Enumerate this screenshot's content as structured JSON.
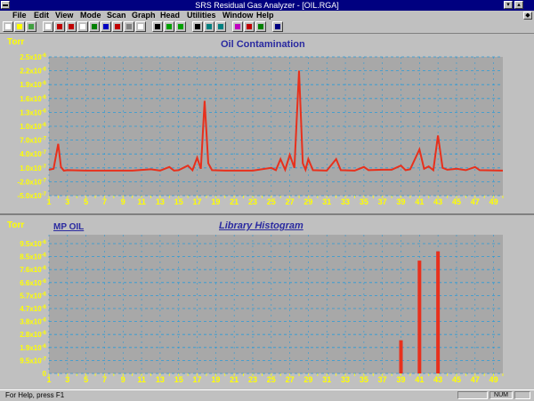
{
  "window": {
    "title": "SRS Residual Gas Analyzer - [OIL.RGA]"
  },
  "menu": [
    "File",
    "Edit",
    "View",
    "Mode",
    "Scan",
    "Graph",
    "Head",
    "Utilities",
    "Window",
    "Help"
  ],
  "toolbar": {
    "buttons": [
      "new-file-icon",
      "open-file-icon",
      "save-icon",
      "print-icon",
      "analog-scan-icon",
      "histogram-icon",
      "table-icon",
      "leak-test-icon",
      "pressure-icon",
      "trend-icon",
      "grid-icon",
      "zoom-icon",
      "autoscale-icon",
      "filament-icon",
      "emission-icon",
      "move-icon",
      "left-arrow-icon",
      "right-arrow-icon",
      "library-icon",
      "compare-icon",
      "record-icon",
      "help-icon"
    ]
  },
  "top_panel": {
    "title": "Oil Contamination",
    "unit": "Torr",
    "y_ticks": [
      "2.5x10-6",
      "2.2x10-6",
      "1.9x10-6",
      "1.6x10-6",
      "1.3x10-6",
      "1.0x10-6",
      "7.0x10-7",
      "4.0x10-7",
      "1.0x10-7",
      "-2.0x10-7",
      "-5.0x10-7"
    ],
    "x_ticks": [
      "1",
      "3",
      "5",
      "7",
      "9",
      "11",
      "13",
      "15",
      "17",
      "19",
      "21",
      "23",
      "25",
      "27",
      "29",
      "31",
      "33",
      "35",
      "37",
      "39",
      "41",
      "43",
      "45",
      "47",
      "49"
    ]
  },
  "bottom_panel": {
    "title": "Library Histogram",
    "library_label": "MP OIL",
    "unit": "Torr",
    "y_ticks": [
      "9.5x10-6",
      "8.5x10-6",
      "7.6x10-6",
      "6.6x10-6",
      "5.7x10-6",
      "4.7x10-6",
      "3.8x10-6",
      "2.8x10-6",
      "1.9x10-6",
      "9.5x10-7",
      "0"
    ],
    "x_ticks": [
      "1",
      "3",
      "5",
      "7",
      "9",
      "11",
      "13",
      "15",
      "17",
      "19",
      "21",
      "23",
      "25",
      "27",
      "29",
      "31",
      "33",
      "35",
      "37",
      "39",
      "41",
      "43",
      "45",
      "47",
      "49"
    ]
  },
  "status": {
    "help_text": "For Help, press F1",
    "num": "NUM"
  },
  "colors": {
    "trace": "#e8301c",
    "plot_bg": "#a8a8a8",
    "grid": "#2a9ad8",
    "axis_text": "#ffff00",
    "title_text": "#2a2aa0"
  },
  "chart_data": [
    {
      "type": "line",
      "title": "Oil Contamination",
      "ylabel": "Torr",
      "xlabel": "",
      "xlim": [
        1,
        50
      ],
      "ylim": [
        -5e-07,
        2.5e-06
      ],
      "grid": true,
      "series": [
        {
          "values": [
            [
              1,
              6e-08
            ],
            [
              1.5,
              8e-08
            ],
            [
              2,
              6.2e-07
            ],
            [
              2.3,
              1.2e-07
            ],
            [
              2.6,
              4e-08
            ],
            [
              3,
              5e-08
            ],
            [
              5,
              4e-08
            ],
            [
              10,
              4e-08
            ],
            [
              12,
              7e-08
            ],
            [
              13,
              4e-08
            ],
            [
              14,
              1.2e-07
            ],
            [
              14.5,
              4e-08
            ],
            [
              15,
              5e-08
            ],
            [
              16,
              1.5e-07
            ],
            [
              16.5,
              5e-08
            ],
            [
              17,
              3.2e-07
            ],
            [
              17.4,
              8e-08
            ],
            [
              17.8,
              1.55e-06
            ],
            [
              18.2,
              2e-07
            ],
            [
              18.6,
              5e-08
            ],
            [
              20,
              4e-08
            ],
            [
              23,
              4e-08
            ],
            [
              25,
              1e-07
            ],
            [
              25.5,
              5e-08
            ],
            [
              26,
              2.9e-07
            ],
            [
              26.5,
              6e-08
            ],
            [
              27,
              3.8e-07
            ],
            [
              27.5,
              1e-07
            ],
            [
              28,
              2.2e-06
            ],
            [
              28.4,
              2e-07
            ],
            [
              28.7,
              6e-08
            ],
            [
              29,
              2.9e-07
            ],
            [
              29.5,
              5e-08
            ],
            [
              31,
              4e-08
            ],
            [
              32,
              2.9e-07
            ],
            [
              32.5,
              5e-08
            ],
            [
              34,
              4e-08
            ],
            [
              35,
              1.2e-07
            ],
            [
              35.5,
              5e-08
            ],
            [
              37,
              6e-08
            ],
            [
              38,
              6e-08
            ],
            [
              39,
              1.5e-07
            ],
            [
              39.5,
              5e-08
            ],
            [
              40,
              7e-08
            ],
            [
              41,
              5e-07
            ],
            [
              41.5,
              8e-08
            ],
            [
              42,
              1.3e-07
            ],
            [
              42.5,
              5e-08
            ],
            [
              43,
              8e-07
            ],
            [
              43.5,
              1e-07
            ],
            [
              44,
              6e-08
            ],
            [
              45,
              8e-08
            ],
            [
              46,
              5e-08
            ],
            [
              47,
              1.2e-07
            ],
            [
              47.5,
              5e-08
            ],
            [
              50,
              4e-08
            ]
          ]
        }
      ]
    },
    {
      "type": "bar",
      "title": "Library Histogram",
      "ylabel": "Torr",
      "xlabel": "",
      "xlim": [
        1,
        50
      ],
      "ylim": [
        0,
        1.045e-05
      ],
      "grid": true,
      "series": [
        {
          "name": "MP OIL",
          "values": [
            [
              39,
              2.5e-06
            ],
            [
              41,
              8.5e-06
            ],
            [
              43,
              9.2e-06
            ]
          ]
        }
      ]
    }
  ]
}
